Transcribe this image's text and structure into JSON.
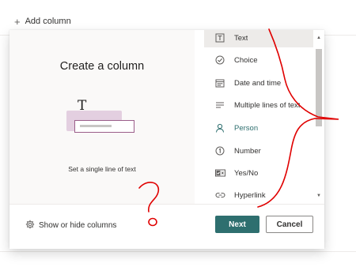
{
  "header": {
    "add_column_label": "Add column",
    "add_column_icon": "plus-icon"
  },
  "dialog": {
    "title": "Create a column",
    "preview_description": "Set a single line of text",
    "column_types": [
      {
        "label": "Text",
        "icon": "text-T-icon",
        "selected": true
      },
      {
        "label": "Choice",
        "icon": "choice-check-icon",
        "selected": false
      },
      {
        "label": "Date and time",
        "icon": "calendar-icon",
        "selected": false
      },
      {
        "label": "Multiple lines of text",
        "icon": "multiline-text-icon",
        "selected": false
      },
      {
        "label": "Person",
        "icon": "person-icon",
        "selected": false
      },
      {
        "label": "Number",
        "icon": "number-icon",
        "selected": false
      },
      {
        "label": "Yes/No",
        "icon": "yes-no-icon",
        "selected": false
      },
      {
        "label": "Hyperlink",
        "icon": "link-icon",
        "selected": false
      }
    ],
    "footer": {
      "show_hide_label": "Show or hide columns",
      "next_label": "Next",
      "cancel_label": "Cancel"
    }
  },
  "colors": {
    "accent": "#2e6f6f",
    "annotation": "#e00000",
    "preview_bg": "#faf9f8",
    "illustration_pink": "#e3cfe0",
    "illustration_border": "#9b5e8a"
  }
}
